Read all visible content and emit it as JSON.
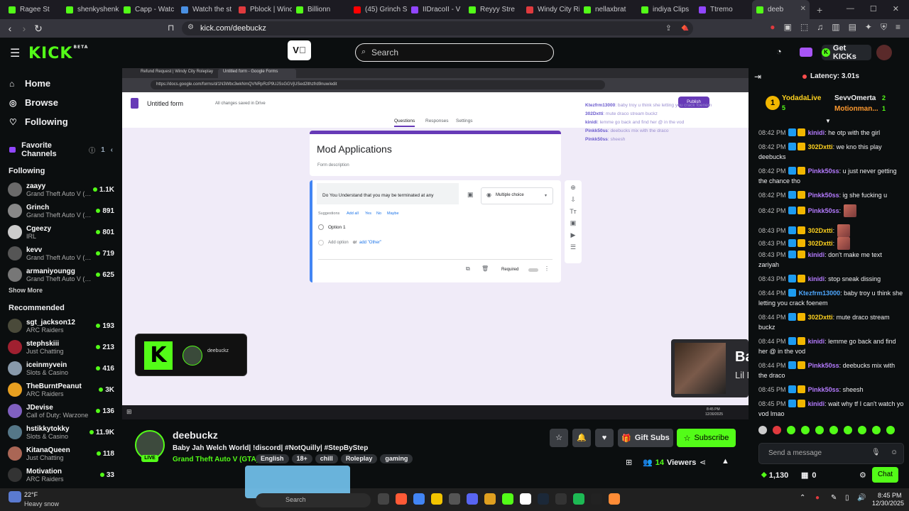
{
  "browser": {
    "tabs": [
      {
        "title": "Ragee St",
        "color": "#53fc18"
      },
      {
        "title": "shenkyshenk",
        "color": "#53fc18"
      },
      {
        "title": "Capp - Watc",
        "color": "#53fc18"
      },
      {
        "title": "Watch the st",
        "color": "#4a90e2"
      },
      {
        "title": "Pblock | Winc",
        "color": "#e03a3e"
      },
      {
        "title": "Billionn",
        "color": "#53fc18"
      },
      {
        "title": "(45) Grinch St",
        "color": "#ff0000"
      },
      {
        "title": "IIDracoII - V",
        "color": "#9146ff"
      },
      {
        "title": "Reyyy Stre",
        "color": "#53fc18"
      },
      {
        "title": "Windy City Ri",
        "color": "#e03a3e"
      },
      {
        "title": "nellaxbrat",
        "color": "#53fc18"
      },
      {
        "title": "indiya Clips",
        "color": "#53fc18"
      },
      {
        "title": "Ttremo",
        "color": "#9146ff"
      },
      {
        "title": "deeb",
        "color": "#53fc18"
      }
    ],
    "url": "kick.com/deebuckz"
  },
  "header": {
    "logo": "KICK",
    "logo_sup": "BETA",
    "search_placeholder": "Search",
    "get_kicks": "Get KICKs"
  },
  "sidebar": {
    "nav": [
      {
        "label": "Home",
        "icon": "home-icon"
      },
      {
        "label": "Browse",
        "icon": "compass-icon"
      },
      {
        "label": "Following",
        "icon": "heart-icon"
      }
    ],
    "favorite_label": "Favorite Channels",
    "favorite_count": "1",
    "following_label": "Following",
    "following": [
      {
        "name": "zaayy",
        "cat": "Grand Theft Auto V (G...",
        "viewers": "1.1K",
        "color": "#6a6a6a"
      },
      {
        "name": "Grinch",
        "cat": "Grand Theft Auto V (G...",
        "viewers": "891",
        "color": "#888"
      },
      {
        "name": "Cgeezy",
        "cat": "IRL",
        "viewers": "801",
        "color": "#ccc"
      },
      {
        "name": "kevv",
        "cat": "Grand Theft Auto V (G...",
        "viewers": "719",
        "color": "#555"
      },
      {
        "name": "armaniyoungg",
        "cat": "Grand Theft Auto V (G...",
        "viewers": "625",
        "color": "#777"
      }
    ],
    "show_more": "Show More",
    "recommended_label": "Recommended",
    "recommended": [
      {
        "name": "sgt_jackson12",
        "cat": "ARC Raiders",
        "viewers": "193",
        "color": "#4a4a3a"
      },
      {
        "name": "stephskiii",
        "cat": "Just Chatting",
        "viewers": "213",
        "color": "#a02030"
      },
      {
        "name": "iceinmyvein",
        "cat": "Slots & Casino",
        "viewers": "416",
        "color": "#8899aa"
      },
      {
        "name": "TheBurntPeanut",
        "cat": "ARC Raiders",
        "viewers": "3K",
        "color": "#e8a020"
      },
      {
        "name": "JDevise",
        "cat": "Call of Duty: Warzone",
        "viewers": "136",
        "color": "#8060c0"
      },
      {
        "name": "hstikkytokky",
        "cat": "Slots & Casino",
        "viewers": "11.9K",
        "color": "#557788"
      },
      {
        "name": "KitanaQueen",
        "cat": "Just Chatting",
        "viewers": "118",
        "color": "#aa6655"
      },
      {
        "name": "Motivation",
        "cat": "ARC Raiders",
        "viewers": "33",
        "color": "#333"
      }
    ]
  },
  "player": {
    "inner_tabs": [
      "Refund Request | Windy City Roleplay",
      "Untitled form - Google Forms"
    ],
    "inner_url": "https://docs.google.com/forms/d/1N3Wbc3wkNmQVNRpRzP9UJSsGGVjUSed2lthzfrd9nuw/edit",
    "form_doc_title": "Untitled form",
    "saved": "All changes saved in Drive",
    "publish": "Publish",
    "form_tabs": [
      "Questions",
      "Responses",
      "Settings"
    ],
    "form_title": "Mod Applications",
    "form_desc": "Form description",
    "question": "Do You Understand that you may be terminated at any",
    "qtype": "Multiple choice",
    "suggestions": [
      "Suggestions",
      "Add all",
      "Yes",
      "No",
      "Maybe"
    ],
    "option1": "Option 1",
    "add_option": "Add option",
    "or": "or",
    "add_other": "add \"Other\"",
    "required": "Required",
    "overlay_chat": [
      {
        "u": "Ktezfrm13000",
        "m": "baby troy u think she letting you crack foenem"
      },
      {
        "u": "302Dxtti",
        "m": "mute draco stream buckz"
      },
      {
        "u": "kinidi",
        "m": "lemme go back and find her @ in the vod"
      },
      {
        "u": "Pinkk50ss",
        "m": "deebucks mix with the draco"
      },
      {
        "u": "Pinkk50ss",
        "m": "sheesh"
      }
    ],
    "cam_name": "deebuckz",
    "song_title": "Backdoor",
    "song_artist": "Lil Durk",
    "time": "8:45 PM",
    "date": "12/30/2025"
  },
  "stream": {
    "streamer": "deebuckz",
    "live": "LIVE",
    "title": "Baby Jah Welch World| !discord| #NotQuilly| #StepByStep",
    "category": "Grand Theft Auto V (GTA)",
    "tags": [
      "English",
      "18+",
      "chill",
      "Roleplay",
      "gaming"
    ],
    "gift_subs": "Gift Subs",
    "subscribe": "Subscribe",
    "viewers": "14",
    "viewers_label": "Viewers"
  },
  "chat": {
    "latency": "Latency: 3.01s",
    "pinned": [
      {
        "name": "YodadaLive",
        "count": "5"
      },
      {
        "name": "SevvOmerta",
        "count": "2"
      },
      {
        "name": "Motionman...",
        "count": "1"
      }
    ],
    "messages": [
      {
        "t": "08:42 PM",
        "u": "kinidi",
        "c": "#b57bff",
        "m": "he otp with the girl"
      },
      {
        "t": "08:42 PM",
        "u": "302Dxtti",
        "c": "#ffd21f",
        "m": "we kno this play deebucks"
      },
      {
        "t": "08:42 PM",
        "u": "Pinkk50ss",
        "c": "#b57bff",
        "m": "u just never getting the chance tho"
      },
      {
        "t": "08:42 PM",
        "u": "Pinkk50ss",
        "c": "#b57bff",
        "m": "ig she fucking u"
      },
      {
        "t": "08:42 PM",
        "u": "Pinkk50ss",
        "c": "#b57bff",
        "m": ""
      },
      {
        "t": "08:43 PM",
        "u": "302Dxtti",
        "c": "#ffd21f",
        "m": ""
      },
      {
        "t": "08:43 PM",
        "u": "302Dxtti",
        "c": "#ffd21f",
        "m": ""
      },
      {
        "t": "08:43 PM",
        "u": "kinidi",
        "c": "#b57bff",
        "m": "don't make me text zariyah"
      },
      {
        "t": "08:43 PM",
        "u": "kinidi",
        "c": "#b57bff",
        "m": "stop sneak dissing"
      },
      {
        "t": "08:44 PM",
        "u": "Ktezfrm13000",
        "c": "#4ea8ff",
        "m": "baby troy u think she letting you crack foenem"
      },
      {
        "t": "08:44 PM",
        "u": "302Dxtti",
        "c": "#ffd21f",
        "m": "mute draco stream buckz"
      },
      {
        "t": "08:44 PM",
        "u": "kinidi",
        "c": "#b57bff",
        "m": "lemme go back and find her @ in the vod"
      },
      {
        "t": "08:44 PM",
        "u": "Pinkk50ss",
        "c": "#b57bff",
        "m": "deebucks mix with the draco"
      },
      {
        "t": "08:45 PM",
        "u": "Pinkk50ss",
        "c": "#b57bff",
        "m": "sheesh"
      },
      {
        "t": "08:45 PM",
        "u": "kinidi",
        "c": "#b57bff",
        "m": "wait why tf I can't watch yo vod lmao"
      }
    ],
    "input_placeholder": "Send a message",
    "points": "1,130",
    "zero": "0",
    "send": "Chat"
  },
  "taskbar": {
    "temp": "22°F",
    "weather": "Heavy snow",
    "search": "Search",
    "time": "8:45 PM",
    "date": "12/30/2025"
  }
}
